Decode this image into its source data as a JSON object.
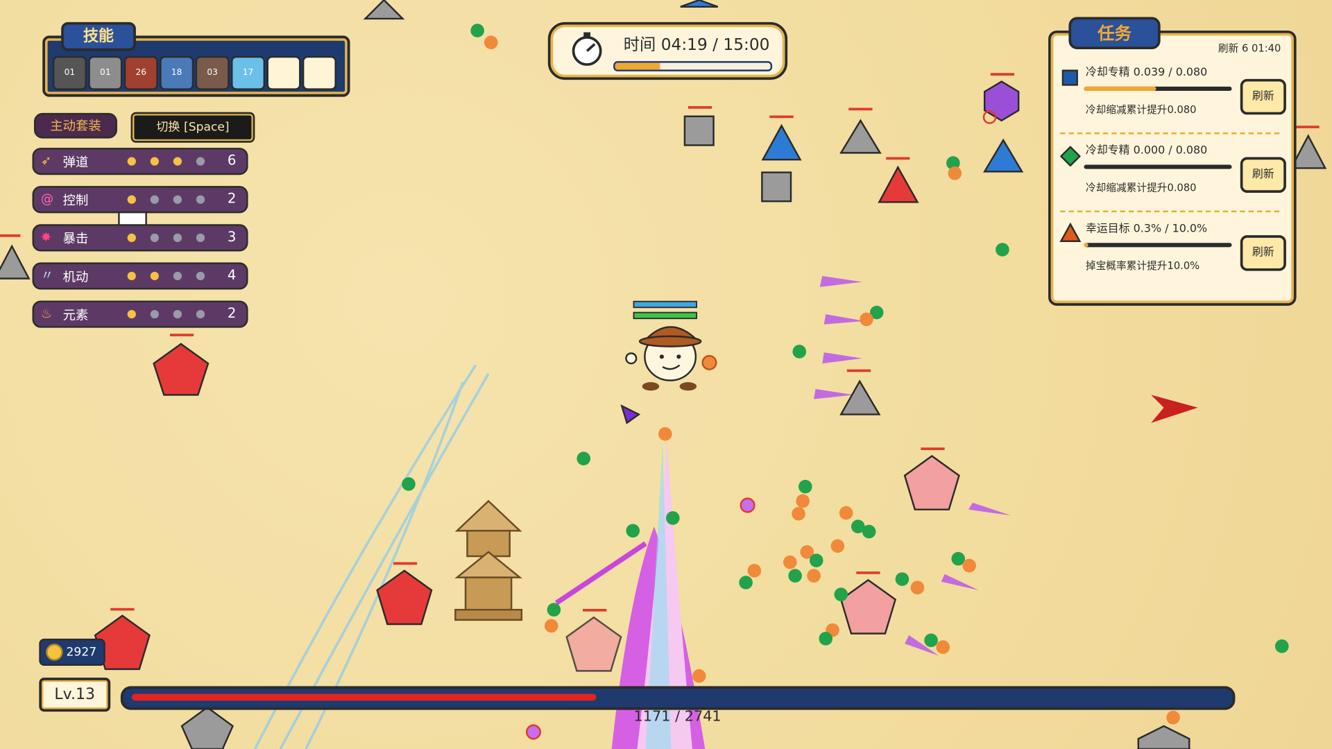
{
  "skills": {
    "title": "技能",
    "slots": [
      {
        "icon": "dark-orb-icon",
        "level": "01"
      },
      {
        "icon": "gray-orb-icon",
        "level": "01"
      },
      {
        "icon": "target-icon",
        "level": "26"
      },
      {
        "icon": "ice-crystal-icon",
        "level": "18"
      },
      {
        "icon": "rock-icon",
        "level": "03"
      },
      {
        "icon": "frost-star-icon",
        "level": "17"
      },
      {
        "icon": "empty-slot",
        "level": ""
      },
      {
        "icon": "empty-slot",
        "level": ""
      }
    ]
  },
  "suit": {
    "active_label": "主动套装",
    "switch_label": "切换 [Space]",
    "traits": [
      {
        "name": "弹道",
        "icon": "arrow-icon",
        "filled": 3,
        "total": 4,
        "value": "6",
        "color": "#f5c242"
      },
      {
        "name": "控制",
        "icon": "spiral-icon",
        "filled": 1,
        "total": 4,
        "value": "2",
        "color": "#ff66aa"
      },
      {
        "name": "暴击",
        "icon": "burst-icon",
        "filled": 1,
        "total": 4,
        "value": "3",
        "color": "#ff4488"
      },
      {
        "name": "机动",
        "icon": "wing-icon",
        "filled": 2,
        "total": 4,
        "value": "4",
        "color": "#bfe0ff"
      },
      {
        "name": "元素",
        "icon": "flame-icon",
        "filled": 1,
        "total": 4,
        "value": "2",
        "color": "#ff9a3a"
      }
    ]
  },
  "timer": {
    "label": "时间 04:19 / 15:00",
    "progress": 0.29
  },
  "missions": {
    "title": "任务",
    "refresh_info": "刷新 6 01:40",
    "refresh_button": "刷新",
    "items": [
      {
        "shape": "square",
        "color": "#1e5aa8",
        "title": "冷却专精 0.039 / 0.080",
        "progress": 0.49,
        "reward": "冷却缩减累计提升0.080"
      },
      {
        "shape": "diamond",
        "color": "#22a24a",
        "title": "冷却专精 0.000 / 0.080",
        "progress": 0.0,
        "reward": "冷却缩减累计提升0.080"
      },
      {
        "shape": "triangle",
        "color": "#e05a1a",
        "title": "幸运目标 0.3% / 10.0%",
        "progress": 0.03,
        "reward": "掉宝概率累计提升10.0%"
      }
    ]
  },
  "player": {
    "gold": "2927",
    "level": "Lv.13",
    "xp_text": "1171 / 2741",
    "xp_progress": 0.427,
    "hp_ratio": 1.0,
    "shield_ratio": 1.0
  },
  "colors": {
    "panel_navy": "#1e3a6e",
    "panel_gold": "#e6b54a",
    "xp_red": "#e32222",
    "enemy_red": "#e63a3a",
    "enemy_gray": "#9b9b9b",
    "enemy_blue": "#2e7bd6",
    "enemy_pink": "#f3a0a0",
    "enemy_purple": "#9b4fd8"
  }
}
